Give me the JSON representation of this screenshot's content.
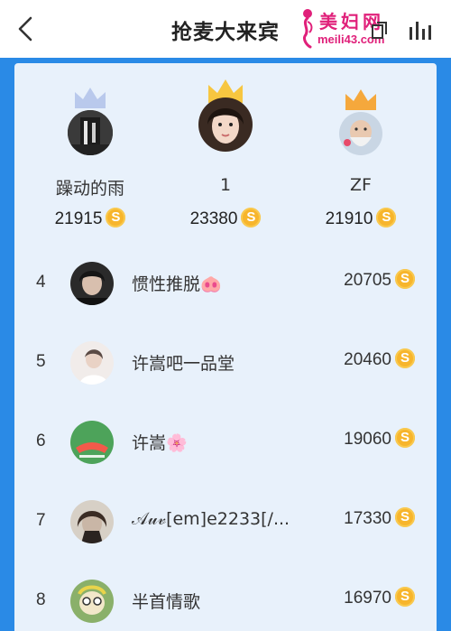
{
  "header": {
    "title": "抢麦大来宾",
    "watermark_cn": "美妇网",
    "watermark_url": "meili43.com"
  },
  "podium": [
    {
      "place": 2,
      "name": "躁动的雨",
      "score": "21915",
      "coin": "S",
      "crown_color": "#b9c9ec"
    },
    {
      "place": 1,
      "name": "1",
      "score": "23380",
      "coin": "S",
      "crown_color": "#f7c640"
    },
    {
      "place": 3,
      "name": "ZF",
      "score": "21910",
      "coin": "S",
      "crown_color": "#f5a83c"
    }
  ],
  "list": [
    {
      "rank": "4",
      "name": "惯性推脱🐽",
      "score": "20705",
      "coin": "S"
    },
    {
      "rank": "5",
      "name": "许嵩吧一品堂",
      "score": "20460",
      "coin": "S"
    },
    {
      "rank": "6",
      "name": "许嵩🌸",
      "score": "19060",
      "coin": "S"
    },
    {
      "rank": "7",
      "name": "𝒜𝓊𝓋[em]e2233[/...",
      "score": "17330",
      "coin": "S"
    },
    {
      "rank": "8",
      "name": "半首情歌",
      "score": "16970",
      "coin": "S"
    }
  ],
  "colors": {
    "frame_blue": "#2a8ae6",
    "panel_bg": "#e8f1fb",
    "coin": "#f7b52c",
    "watermark": "#e0207a"
  }
}
